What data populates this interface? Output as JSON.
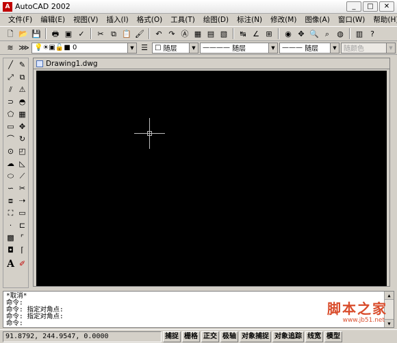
{
  "window": {
    "title": "AutoCAD 2002",
    "app_icon": "autocad-logo"
  },
  "menu": [
    "文件(F)",
    "编辑(E)",
    "视图(V)",
    "插入(I)",
    "格式(O)",
    "工具(T)",
    "绘图(D)",
    "标注(N)",
    "修改(M)",
    "图像(A)",
    "窗口(W)",
    "帮助(H)"
  ],
  "toolbar_standard": {
    "icons": [
      "new-file",
      "open-file",
      "save",
      "print",
      "print-preview",
      "spelling",
      "cut",
      "copy",
      "paste",
      "match-properties",
      "undo",
      "redo",
      "autocad-today",
      "line-tool",
      "dimension-tool",
      "text-tool",
      "pan-tool",
      "zoom-realtime",
      "zoom-window",
      "named-views",
      "3d-orbit",
      "ucs",
      "properties",
      "design-center",
      "tool-palette",
      "help"
    ]
  },
  "layer_bar": {
    "layer_value": "0",
    "color_value": "随层",
    "linetype_value": "随层",
    "lineweight_value": "随层",
    "plotstyle_value": "随颜色"
  },
  "draw_window": {
    "title": "Drawing1.dwg",
    "background": "#000000",
    "crosshair_color": "#bdbdbd"
  },
  "command": {
    "lines": [
      "*取消*",
      "命令:",
      "命令: 指定对角点:",
      "命令: 指定对角点:",
      "命令:"
    ]
  },
  "status": {
    "coords": "91.8792, 244.9547, 0.0000",
    "buttons": [
      "捕捉",
      "栅格",
      "正交",
      "极轴",
      "对象捕捉",
      "对象追踪",
      "线宽",
      "模型"
    ]
  },
  "watermark": {
    "text": "脚本之家",
    "url": "www.jb51.net"
  }
}
